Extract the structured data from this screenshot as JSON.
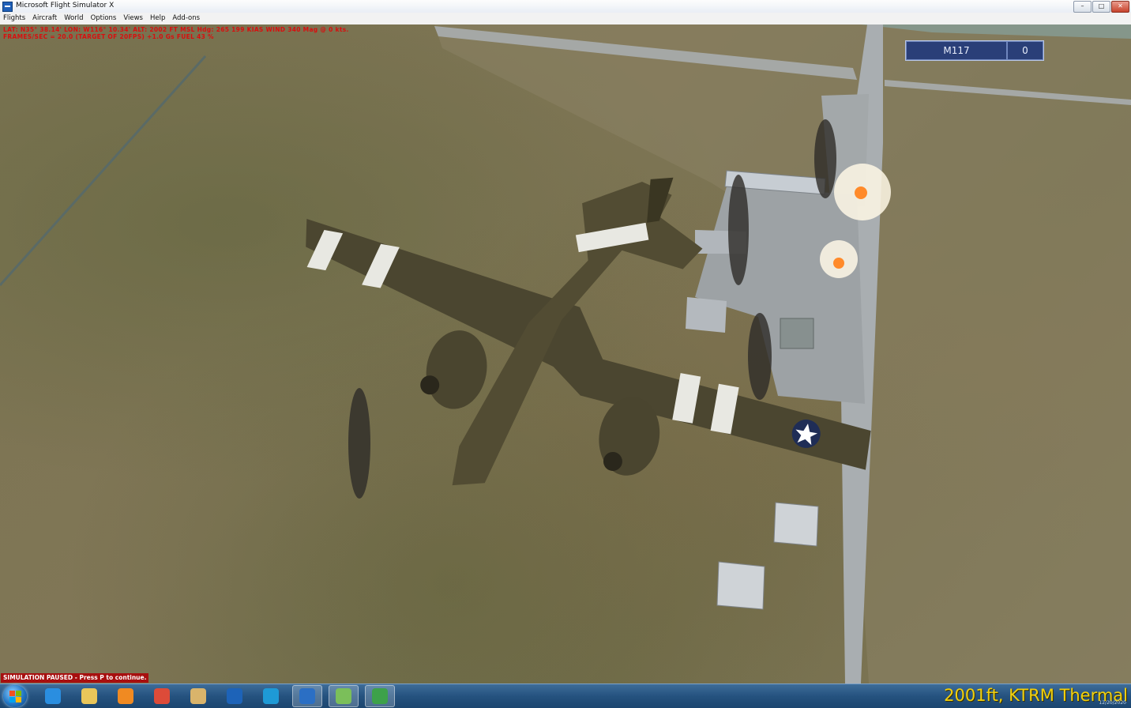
{
  "window": {
    "title": "Microsoft Flight Simulator X",
    "buttons": [
      "–",
      "□",
      "✕"
    ]
  },
  "menu": [
    "Flights",
    "Aircraft",
    "World",
    "Options",
    "Views",
    "Help",
    "Add-ons"
  ],
  "hud": {
    "line1": "LAT: N35° 38.14'  LON: W116° 10.34'  ALT: 2002 FT  MSL  Hdg: 265  199 KIAS  WIND 340 Mag @ 0 kts.",
    "line2": "FRAMES/SEC = 20.0   (TARGET OF 20FPS)   +1.0 Gs   FUEL 43 %"
  },
  "scoreboard": {
    "weapon": "M117",
    "count": "0"
  },
  "pause_message": "SIMULATION PAUSED - Press P to continue.",
  "status_overlay": "2001ft, KTRM Thermal",
  "tray": {
    "date": "12/20/2020"
  },
  "taskbar_icons": [
    {
      "name": "internet-explorer-icon",
      "color": "#2a8ee0"
    },
    {
      "name": "file-explorer-icon",
      "color": "#e9c65a"
    },
    {
      "name": "media-player-icon",
      "color": "#f08a22"
    },
    {
      "name": "chrome-icon",
      "color": "#dd4b39"
    },
    {
      "name": "paint-icon",
      "color": "#d9b46b"
    },
    {
      "name": "n-app-icon",
      "color": "#1d63b8"
    },
    {
      "name": "edge-icon",
      "color": "#1e9ad6"
    },
    {
      "name": "flight-sim-icon",
      "color": "#2b6fc4"
    },
    {
      "name": "aircraft-app-icon",
      "color": "#7bbf5a"
    },
    {
      "name": "download-app-icon",
      "color": "#3da14a"
    }
  ]
}
